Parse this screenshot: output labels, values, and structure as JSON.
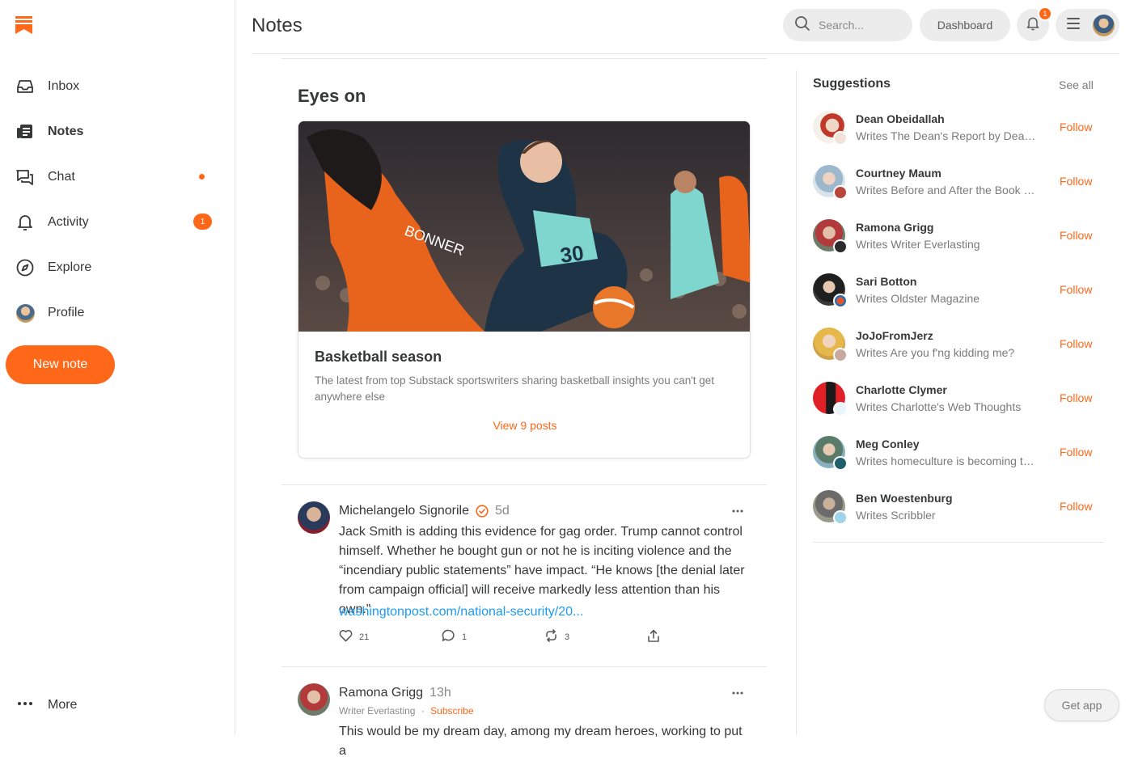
{
  "app": {
    "brand_color": "#ff6719",
    "link_color": "#1d9bf0"
  },
  "sidebar": {
    "items": [
      {
        "label": "Inbox",
        "icon": "inbox-icon"
      },
      {
        "label": "Notes",
        "icon": "notes-icon",
        "active": true
      },
      {
        "label": "Chat",
        "icon": "chat-icon",
        "unread_dot": true
      },
      {
        "label": "Activity",
        "icon": "bell-icon",
        "badge": "1"
      },
      {
        "label": "Explore",
        "icon": "compass-icon"
      },
      {
        "label": "Profile",
        "icon": "avatar"
      }
    ],
    "new_note_label": "New note",
    "more_label": "More"
  },
  "header": {
    "title": "Notes",
    "search_placeholder": "Search...",
    "dashboard_label": "Dashboard",
    "notification_count": "1"
  },
  "feed": {
    "section_title": "Eyes on",
    "card": {
      "title": "Basketball season",
      "description": "The latest from top Substack sportswriters sharing basketball insights you can't get anywhere else",
      "link_label": "View 9 posts"
    },
    "posts": [
      {
        "author": "Michelangelo Signorile",
        "verified": true,
        "time": "5d",
        "body": "Jack Smith is adding this evidence for gag order. Trump cannot control himself. Whether he bought gun or not he is inciting violence and the “incendiary public statements” have impact. “He knows [the denial later from campaign official] will receive markedly less attention than his own.”",
        "link": "washingtonpost.com/national-security/20...",
        "likes": "21",
        "comments": "1",
        "restacks": "3"
      },
      {
        "author": "Ramona Grigg",
        "time": "13h",
        "publication": "Writer Everlasting",
        "separator": "·",
        "subscribe_label": "Subscribe",
        "body": "This would be my dream day, among my dream heroes, working to put a"
      }
    ]
  },
  "suggestions": {
    "title": "Suggestions",
    "see_all_label": "See all",
    "follow_label": "Follow",
    "items": [
      {
        "name": "Dean Obeidallah",
        "desc": "Writes The Dean's Report by Dean Obeidallah"
      },
      {
        "name": "Courtney Maum",
        "desc": "Writes Before and After the Book Deal"
      },
      {
        "name": "Ramona Grigg",
        "desc": "Writes Writer Everlasting"
      },
      {
        "name": "Sari Botton",
        "desc": "Writes Oldster Magazine"
      },
      {
        "name": "JoJoFromJerz",
        "desc": "Writes Are you f'ng kidding me?"
      },
      {
        "name": "Charlotte Clymer",
        "desc": "Writes Charlotte's Web Thoughts"
      },
      {
        "name": "Meg Conley",
        "desc": "Writes homeculture is becoming the thing"
      },
      {
        "name": "Ben Woestenburg",
        "desc": "Writes Scribbler"
      }
    ]
  },
  "get_app_label": "Get app"
}
